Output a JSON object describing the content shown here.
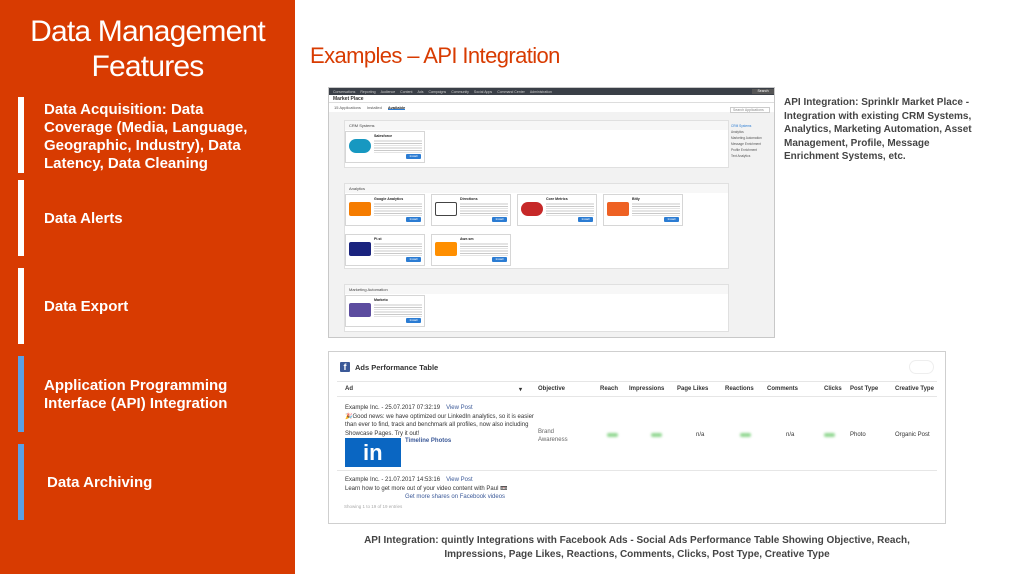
{
  "sidebar": {
    "title_line1": "Data Management",
    "title_line2": "Features",
    "items": [
      {
        "label_lines": [
          "Data Acquisition: Data",
          "Coverage (Media, Language,",
          "Geographic, Industry), Data",
          "Latency, Data Cleaning"
        ],
        "bar_color": "#ffffff"
      },
      {
        "label_lines": [
          "Data Alerts"
        ],
        "bar_color": "#ffffff"
      },
      {
        "label_lines": [
          "Data Export"
        ],
        "bar_color": "#ffffff"
      },
      {
        "label_lines": [
          "Application Programming",
          "Interface (API) Integration"
        ],
        "bar_color": "#5aa0e6"
      },
      {
        "label_lines": [
          "Data Archiving"
        ],
        "bar_color": "#5aa0e6"
      }
    ]
  },
  "main": {
    "title": "Examples – API Integration"
  },
  "marketplace": {
    "nav_items": [
      "Conversations",
      "Reporting",
      "Audience",
      "Content",
      "Ads",
      "Campaigns",
      "Community",
      "Social Apps",
      "Command Center",
      "Administration"
    ],
    "search_label": "Search",
    "header": "Market Place",
    "tabs": [
      "15 Applications",
      "Installed",
      "Available"
    ],
    "search_placeholder": "Search Applications",
    "side_menu": [
      "CRM Systems",
      "Analytics",
      "Marketing Automation",
      "Message Enrichment",
      "Profile Enrichment",
      "Text Analytics"
    ],
    "install_label": "Install",
    "sections": [
      {
        "label": "CRM Systems",
        "cards": [
          {
            "name": "Salesforce",
            "logo_color": "#1798c1"
          }
        ]
      },
      {
        "label": "Analytics",
        "cards": [
          {
            "name": "Google Analytics",
            "logo_color": "#f57c00"
          },
          {
            "name": "Directions",
            "logo_color": "#444444"
          },
          {
            "name": "Core Metrics",
            "logo_color": "#c62828"
          },
          {
            "name": "Bitly",
            "logo_color": "#ee6123"
          },
          {
            "name": "Pi.st",
            "logo_color": "#1a237e"
          },
          {
            "name": "Awe.sm",
            "logo_color": "#ff8f00"
          }
        ]
      },
      {
        "label": "Marketing Automation",
        "cards": [
          {
            "name": "Marketo",
            "logo_color": "#5c4c9f"
          }
        ]
      }
    ]
  },
  "ads_table": {
    "title": "Ads Performance Table",
    "columns": [
      "Ad",
      "Objective",
      "Reach",
      "Impressions",
      "Page Likes",
      "Reactions",
      "Comments",
      "Clicks",
      "Post Type",
      "Creative Type"
    ],
    "rows": [
      {
        "advertiser": "Example Inc. - 25.07.2017 07:32:19",
        "view_post": "View Post",
        "text_lines": [
          "🎉Good news: we have optimized our LinkedIn analytics, so it is easier",
          "than ever to find, track and benchmark all profiles, now also including",
          "Showcase Pages. Try it out!"
        ],
        "link_label": "Timeline Photos",
        "objective_lines": [
          "Brand",
          "Awareness"
        ],
        "page_likes": "n/a",
        "comments": "n/a",
        "post_type": "Photo",
        "creative_type": "Organic Post"
      },
      {
        "advertiser": "Example Inc. - 21.07.2017 14:53:16",
        "view_post": "View Post",
        "text_lines": [
          "Learn how to get more out of your video content with Paul 📼"
        ],
        "link_label": "Get more shares on Facebook videos"
      }
    ],
    "footer": "Showing 1 to 19 of 19 entries"
  },
  "captions": {
    "right": "API Integration: Sprinklr Market Place - Integration with existing CRM Systems, Analytics, Marketing Automation, Asset Management, Profile, Message Enrichment Systems, etc.",
    "bottom": "API Integration: quintly Integrations with Facebook Ads - Social Ads Performance Table  Showing Objective, Reach, Impressions, Page Likes, Reactions, Comments, Clicks, Post Type, Creative Type"
  }
}
